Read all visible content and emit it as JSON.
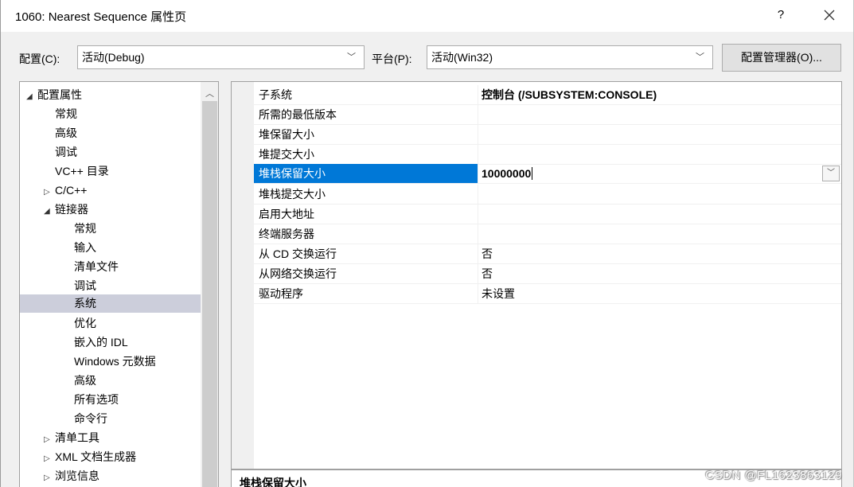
{
  "window": {
    "title": "1060: Nearest Sequence 属性页",
    "help_label": "?"
  },
  "config": {
    "label": "配置(C):",
    "value": "活动(Debug)",
    "platform_label": "平台(P):",
    "platform_value": "活动(Win32)",
    "manager_button": "配置管理器(O)..."
  },
  "tree": {
    "items": [
      {
        "label": "配置属性",
        "expander": "◢"
      },
      {
        "label": "常规"
      },
      {
        "label": "高级"
      },
      {
        "label": "调试"
      },
      {
        "label": "VC++ 目录"
      },
      {
        "label": "C/C++",
        "expander": "▷"
      },
      {
        "label": "链接器",
        "expander": "◢"
      },
      {
        "label": "常规"
      },
      {
        "label": "输入"
      },
      {
        "label": "清单文件"
      },
      {
        "label": "调试"
      },
      {
        "label": "系统"
      },
      {
        "label": "优化"
      },
      {
        "label": "嵌入的 IDL"
      },
      {
        "label": "Windows 元数据"
      },
      {
        "label": "高级"
      },
      {
        "label": "所有选项"
      },
      {
        "label": "命令行"
      },
      {
        "label": "清单工具",
        "expander": "▷"
      },
      {
        "label": "XML 文档生成器",
        "expander": "▷"
      },
      {
        "label": "浏览信息",
        "expander": "▷"
      }
    ]
  },
  "properties": {
    "rows": [
      {
        "name": "子系统",
        "value": "控制台 (/SUBSYSTEM:CONSOLE)"
      },
      {
        "name": "所需的最低版本",
        "value": ""
      },
      {
        "name": "堆保留大小",
        "value": ""
      },
      {
        "name": "堆提交大小",
        "value": ""
      },
      {
        "name": "堆栈保留大小",
        "value": "10000000"
      },
      {
        "name": "堆栈提交大小",
        "value": ""
      },
      {
        "name": "启用大地址",
        "value": ""
      },
      {
        "name": "终端服务器",
        "value": ""
      },
      {
        "name": "从 CD 交换运行",
        "value": "否"
      },
      {
        "name": "从网络交换运行",
        "value": "否"
      },
      {
        "name": "驱动程序",
        "value": "未设置"
      }
    ]
  },
  "description": {
    "title": "堆栈保留大小"
  },
  "watermark": "CSDN @FL1623863129",
  "colors": {
    "selection": "#0078d7",
    "tree_selection": "#cccedb"
  }
}
